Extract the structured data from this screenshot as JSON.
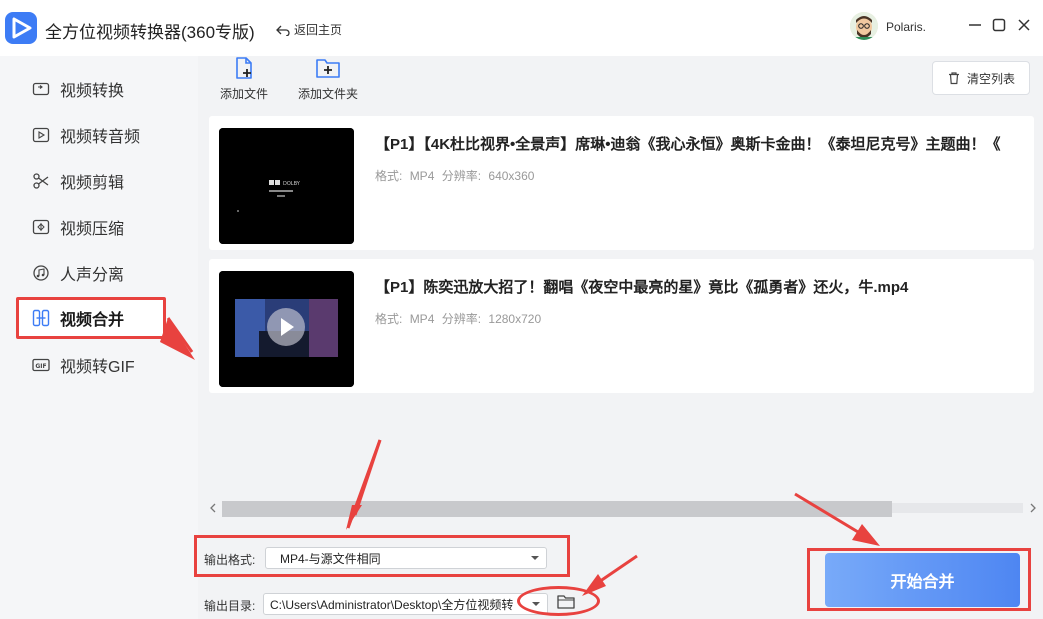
{
  "window": {
    "title": "全方位视频转换器(360专版)",
    "back_home": "返回主页",
    "username": "Polaris."
  },
  "sidebar": {
    "items": [
      {
        "label": "视频转换",
        "icon": "video-convert-icon"
      },
      {
        "label": "视频转音频",
        "icon": "video-to-audio-icon"
      },
      {
        "label": "视频剪辑",
        "icon": "scissors-icon"
      },
      {
        "label": "视频压缩",
        "icon": "compress-icon"
      },
      {
        "label": "人声分离",
        "icon": "vocal-separate-icon"
      },
      {
        "label": "视频合并",
        "icon": "merge-icon",
        "active": true
      },
      {
        "label": "视频转GIF",
        "icon": "gif-icon"
      }
    ]
  },
  "toolbar": {
    "add_file": "添加文件",
    "add_folder": "添加文件夹",
    "clear_list": "清空列表"
  },
  "files": [
    {
      "title": "【P1】【4K杜比视界•全景声】席琳•迪翁《我心永恒》奥斯卡金曲！《泰坦尼克号》主题曲！《",
      "format_label": "格式:",
      "format": "MP4",
      "resolution_label": "分辨率:",
      "resolution": "640x360",
      "thumb_text": "DOLBY"
    },
    {
      "title": "【P1】陈奕迅放大招了！翻唱《夜空中最亮的星》竟比《孤勇者》还火，牛.mp4",
      "format_label": "格式:",
      "format": "MP4",
      "resolution_label": "分辨率:",
      "resolution": "1280x720"
    }
  ],
  "output": {
    "format_label": "输出格式:",
    "format_value": "MP4-与源文件相同",
    "dir_label": "输出目录:",
    "dir_value": "C:\\Users\\Administrator\\Desktop\\全方位视频转"
  },
  "actions": {
    "start_merge": "开始合并"
  },
  "colors": {
    "accent": "#4e86f2",
    "annotation": "#e8423f",
    "sidebar_bg": "#f5f6f8",
    "main_bg": "#f2f3f5"
  }
}
